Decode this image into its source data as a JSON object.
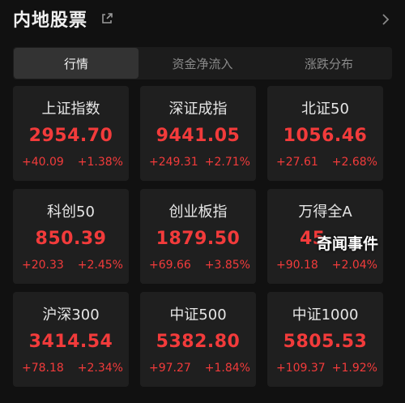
{
  "header": {
    "title": "内地股票",
    "share_icon": "external-share-icon",
    "chevron_icon": "chevron-right-icon"
  },
  "tabs": [
    {
      "label": "行情",
      "active": true
    },
    {
      "label": "资金净流入",
      "active": false
    },
    {
      "label": "涨跌分布",
      "active": false
    }
  ],
  "indices": [
    {
      "name": "上证指数",
      "price": "2954.70",
      "change": "+40.09",
      "pct": "+1.38%"
    },
    {
      "name": "深证成指",
      "price": "9441.05",
      "change": "+249.31",
      "pct": "+2.71%"
    },
    {
      "name": "北证50",
      "price": "1056.46",
      "change": "+27.61",
      "pct": "+2.68%"
    },
    {
      "name": "科创50",
      "price": "850.39",
      "change": "+20.33",
      "pct": "+2.45%"
    },
    {
      "name": "创业板指",
      "price": "1879.50",
      "change": "+69.66",
      "pct": "+3.85%"
    },
    {
      "name": "万得全A",
      "price": "45",
      "change": "+90.18",
      "pct": "+2.04%"
    },
    {
      "name": "沪深300",
      "price": "3414.54",
      "change": "+78.18",
      "pct": "+2.34%"
    },
    {
      "name": "中证500",
      "price": "5382.80",
      "change": "+97.27",
      "pct": "+1.84%"
    },
    {
      "name": "中证1000",
      "price": "5805.53",
      "change": "+109.37",
      "pct": "+1.92%"
    }
  ],
  "watermark": "奇闻事件",
  "colors": {
    "up": "#f23b3b",
    "background": "#111111",
    "card": "#1f1f1f"
  }
}
